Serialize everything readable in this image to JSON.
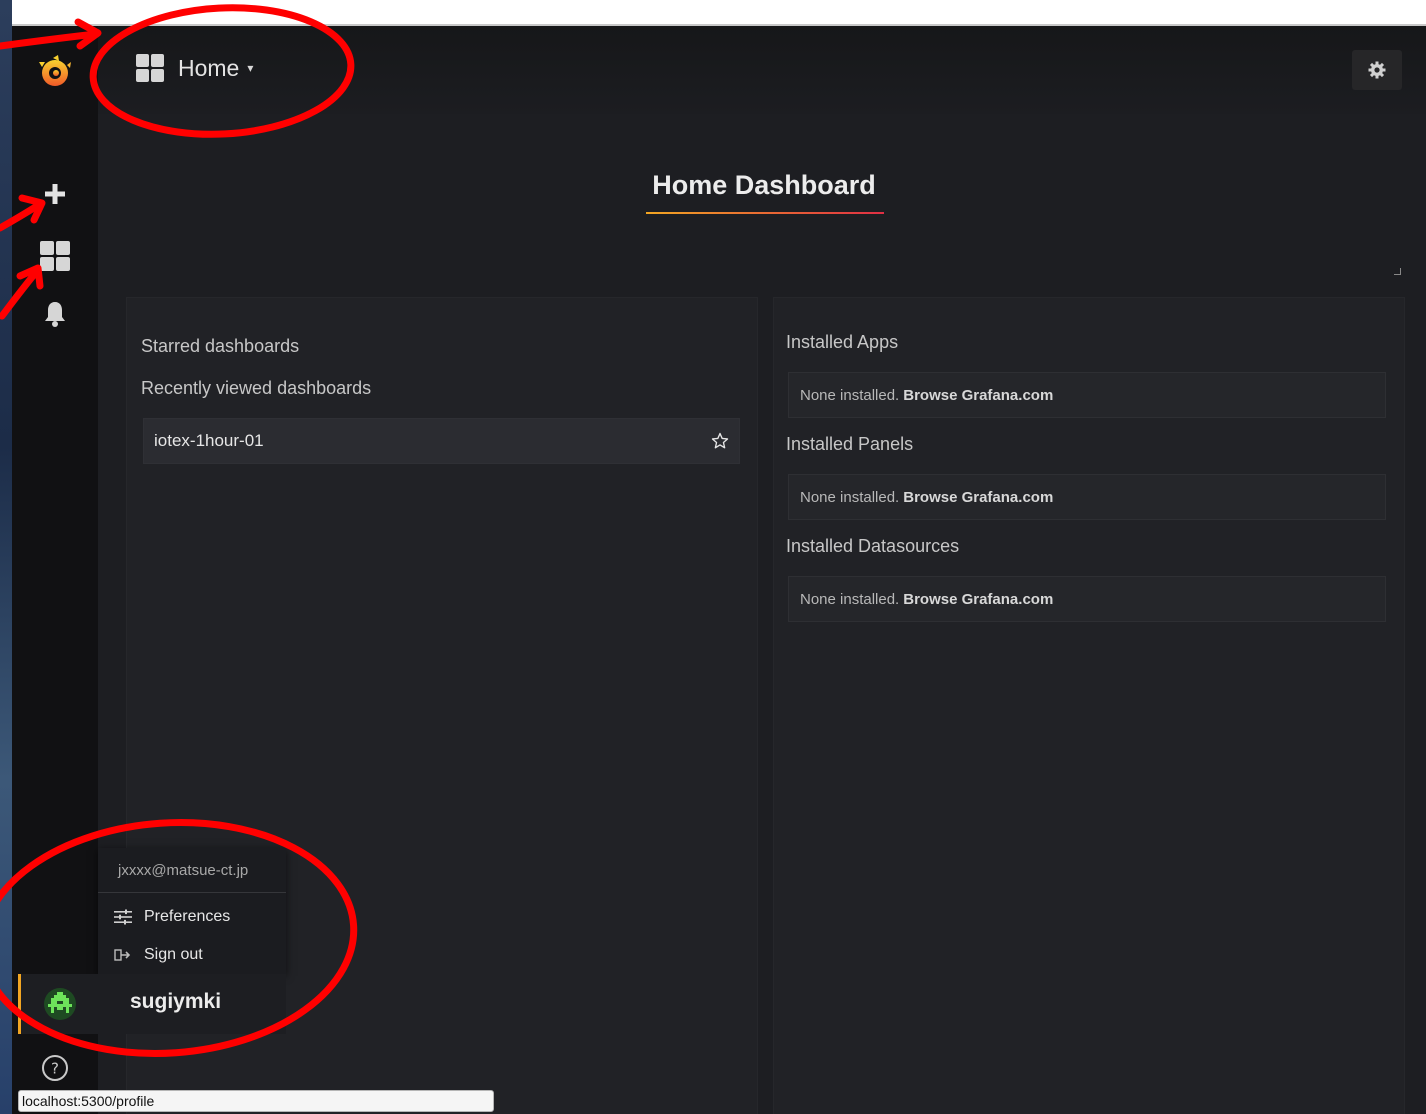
{
  "navbar": {
    "home_label": "Home",
    "home_caret": "▾"
  },
  "dashboard": {
    "title": "Home Dashboard"
  },
  "left_panel": {
    "starred_heading": "Starred dashboards",
    "recent_heading": "Recently viewed dashboards",
    "recent_items": [
      {
        "label": "iotex-1hour-01"
      }
    ]
  },
  "right_panel": {
    "apps_heading": "Installed Apps",
    "panels_heading": "Installed Panels",
    "datasources_heading": "Installed Datasources",
    "none_installed": "None installed.",
    "browse_link": "Browse Grafana.com"
  },
  "profile_menu": {
    "email": "jxxxx@matsue-ct.jp",
    "preferences": "Preferences",
    "sign_out": "Sign out",
    "username": "sugiymki"
  },
  "status_bar": {
    "url": "localhost:5300/profile"
  },
  "icons": {
    "logo": "grafana-logo-icon",
    "plus": "plus-icon",
    "dashboards": "dashboards-grid-icon",
    "alerting": "bell-icon",
    "help": "help-icon",
    "settings": "gear-icon",
    "star": "star-icon",
    "preferences": "sliders-icon",
    "sign_out": "sign-out-icon",
    "avatar": "avatar-icon"
  },
  "colors": {
    "background": "#161719",
    "panel": "#212226",
    "accent_orange": "#f2a623",
    "accent_red": "#e02f44",
    "annotation_red": "#ff0000"
  }
}
